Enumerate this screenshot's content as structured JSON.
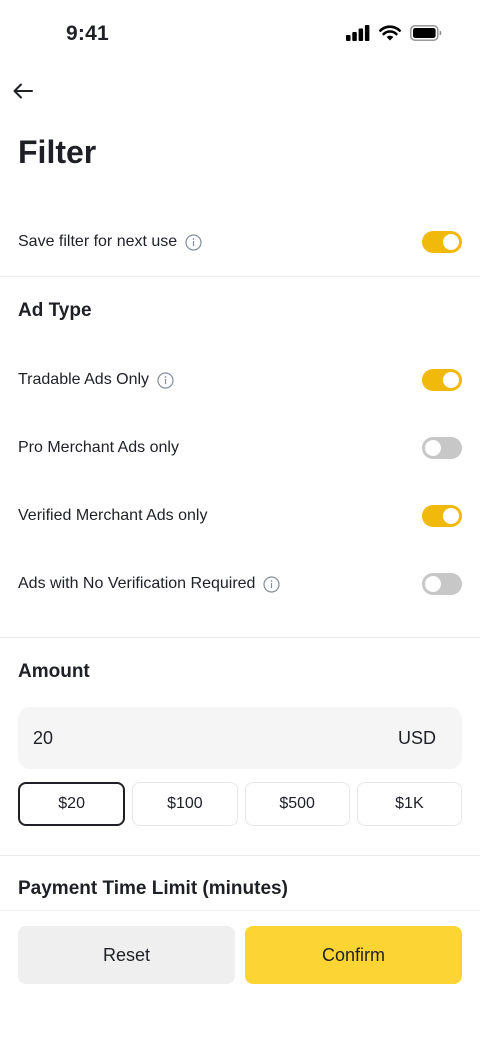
{
  "status_bar": {
    "time": "9:41",
    "icons": [
      "cellular-signal-icon",
      "wifi-icon",
      "battery-icon"
    ]
  },
  "header": {
    "back_icon": "arrow-left-icon",
    "title": "Filter"
  },
  "save_filter": {
    "label": "Save filter for next use",
    "info_icon": "info-icon",
    "enabled": true
  },
  "ad_type": {
    "title": "Ad Type",
    "options": [
      {
        "label": "Tradable Ads Only",
        "has_info": true,
        "enabled": true
      },
      {
        "label": "Pro Merchant Ads only",
        "has_info": false,
        "enabled": false
      },
      {
        "label": "Verified Merchant Ads only",
        "has_info": false,
        "enabled": true
      },
      {
        "label": "Ads with No Verification Required",
        "has_info": true,
        "enabled": false
      }
    ]
  },
  "amount": {
    "title": "Amount",
    "value": "20",
    "currency": "USD",
    "presets": [
      "$20",
      "$100",
      "$500",
      "$1K"
    ],
    "selected_preset": "$20"
  },
  "payment_time": {
    "title": "Payment Time Limit (minutes)"
  },
  "footer": {
    "reset_label": "Reset",
    "confirm_label": "Confirm"
  },
  "colors": {
    "toggle_on": "#f0b90b",
    "toggle_off": "#c7c7c7",
    "confirm_bg": "#fcd535",
    "reset_bg": "#efefef",
    "text": "#1e2026"
  }
}
